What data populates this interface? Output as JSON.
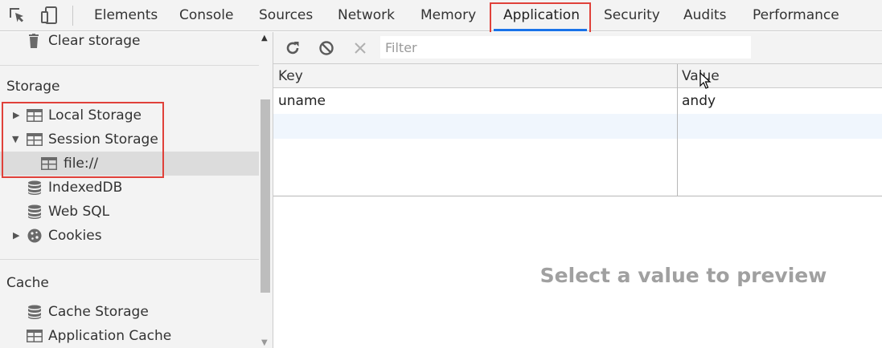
{
  "toolbar": {
    "icons": [
      "inspect-element-icon",
      "device-toolbar-icon"
    ],
    "tabs": [
      "Elements",
      "Console",
      "Sources",
      "Network",
      "Memory",
      "Application",
      "Security",
      "Audits",
      "Performance"
    ],
    "active_tab": "Application"
  },
  "sidebar": {
    "clear_storage": "Clear storage",
    "storage_title": "Storage",
    "storage_items": {
      "local_storage": "Local Storage",
      "session_storage": "Session Storage",
      "session_file": "file://",
      "indexeddb": "IndexedDB",
      "web_sql": "Web SQL",
      "cookies": "Cookies"
    },
    "cache_title": "Cache",
    "cache_items": {
      "cache_storage": "Cache Storage",
      "application_cache": "Application Cache"
    }
  },
  "main": {
    "filter_placeholder": "Filter",
    "columns": {
      "key": "Key",
      "value": "Value"
    },
    "rows": [
      {
        "key": "uname",
        "value": "andy"
      }
    ],
    "preview_text": "Select a value to preview"
  },
  "colors": {
    "accent": "#1a73e8",
    "highlight_box": "#e0413a",
    "selected_row": "#dcdcdc"
  }
}
